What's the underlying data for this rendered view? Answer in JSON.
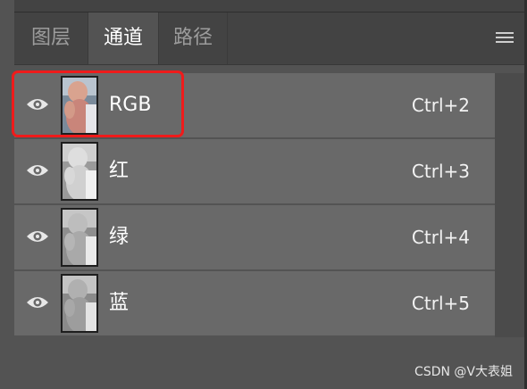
{
  "tabs": [
    {
      "label": "图层",
      "active": false
    },
    {
      "label": "通道",
      "active": true
    },
    {
      "label": "路径",
      "active": false
    }
  ],
  "panel_menu_icon": "hamburger-menu-icon",
  "channels": [
    {
      "name": "RGB",
      "shortcut": "Ctrl+2",
      "visible": true,
      "thumbnail": "color"
    },
    {
      "name": "红",
      "shortcut": "Ctrl+3",
      "visible": true,
      "thumbnail": "grayscale"
    },
    {
      "name": "绿",
      "shortcut": "Ctrl+4",
      "visible": true,
      "thumbnail": "grayscale"
    },
    {
      "name": "蓝",
      "shortcut": "Ctrl+5",
      "visible": true,
      "thumbnail": "grayscale"
    }
  ],
  "watermark": "CSDN @V大表姐",
  "colors": {
    "highlight": "#ef1b1b",
    "row_bg": "#696969",
    "tab_bar_bg": "#434343",
    "active_tab_bg": "#535353"
  }
}
